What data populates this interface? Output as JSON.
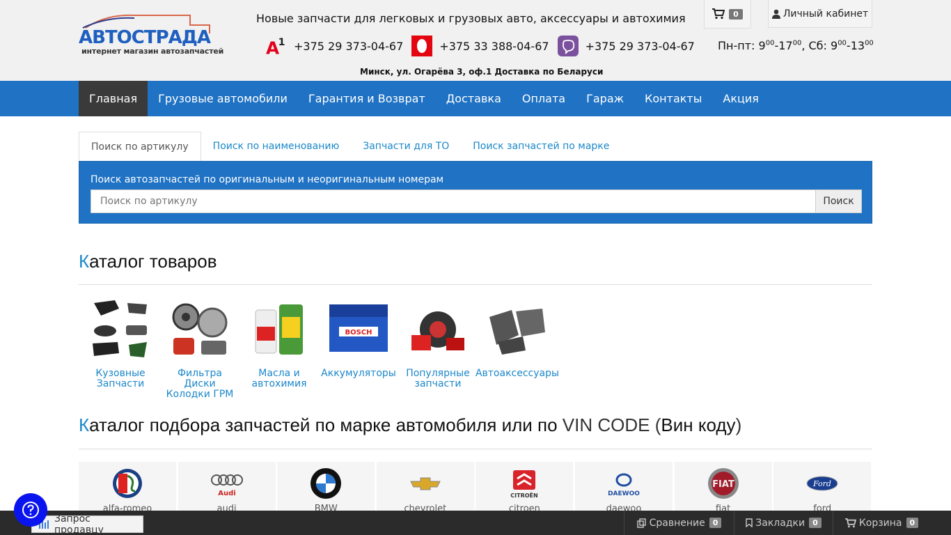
{
  "header": {
    "logo_sub": "интернет магазин автозапчастей",
    "tagline": "Новые запчасти для легковых и грузовых авто, аксессуары и автохимия",
    "phones": [
      {
        "operator_icon": "a1-logo-icon",
        "number": "+375 29 373-04-67"
      },
      {
        "operator_icon": "mts-logo-icon",
        "number": "+375 33 388-04-67"
      },
      {
        "operator_icon": "viber-icon",
        "number": "+375 29 373-04-67"
      }
    ],
    "address": "Минск, ул. Огарёва 3, оф.1  Доставка по Беларуси",
    "cart_count": "0",
    "account_label": "Личный кабинет",
    "hours": {
      "weekday_label": "Пн-пт: 9",
      "weekday_from_min": "00",
      "weekday_to": "-17",
      "weekday_to_min": "00",
      "sat_label": ", Сб: 9",
      "sat_from_min": "00",
      "sat_to": "-13",
      "sat_to_min": "00"
    }
  },
  "nav": {
    "items": [
      "Главная",
      "Грузовые автомобили",
      "Гарантия и Возврат",
      "Доставка",
      "Оплата",
      "Гараж",
      "Контакты",
      "Акция"
    ]
  },
  "search": {
    "tabs": [
      "Поиск по артикулу",
      "Поиск по наименованию",
      "Запчасти для ТО",
      "Поиск запчастей по марке"
    ],
    "label": "Поиск автозапчастей по оригинальным и неоригинальным номерам",
    "placeholder": "Поиск по артикулу",
    "button": "Поиск"
  },
  "catalog": {
    "title_first": "К",
    "title_rest": "аталог товаров",
    "items": [
      {
        "label_l1": "Кузовные",
        "label_l2": "Запчасти",
        "label_l3": ""
      },
      {
        "label_l1": "Фильтра",
        "label_l2": "Диски",
        "label_l3": "Колодки ГРМ"
      },
      {
        "label_l1": "Масла и",
        "label_l2": "автохимия",
        "label_l3": ""
      },
      {
        "label_l1": "Аккумуляторы",
        "label_l2": "",
        "label_l3": ""
      },
      {
        "label_l1": "Популярные",
        "label_l2": "запчасти",
        "label_l3": ""
      },
      {
        "label_l1": "Автоаксессуары",
        "label_l2": "",
        "label_l3": ""
      }
    ]
  },
  "brands_section": {
    "title_first": "К",
    "title_mid": "аталог подбора запчастей по марке автомобиля или по ",
    "title_light": "VIN CODE (",
    "title_bold": "Вин коду",
    "title_end": ")",
    "brands": [
      "alfa-romeo",
      "audi",
      "BMW",
      "chevrolet",
      "citroen",
      "daewoo",
      "fiat",
      "ford"
    ]
  },
  "bottombar": {
    "seller_request": "Запрос продавцу",
    "compare_label": "Сравнение",
    "compare_count": "0",
    "bookmarks_label": "Закладки",
    "bookmarks_count": "0",
    "cart_label": "Корзина",
    "cart_count": "0"
  },
  "colors": {
    "nav_bg": "#1f72c4",
    "accent": "#1b87c9",
    "active_nav": "#3a3a3a",
    "help_button": "#0a14ee"
  }
}
